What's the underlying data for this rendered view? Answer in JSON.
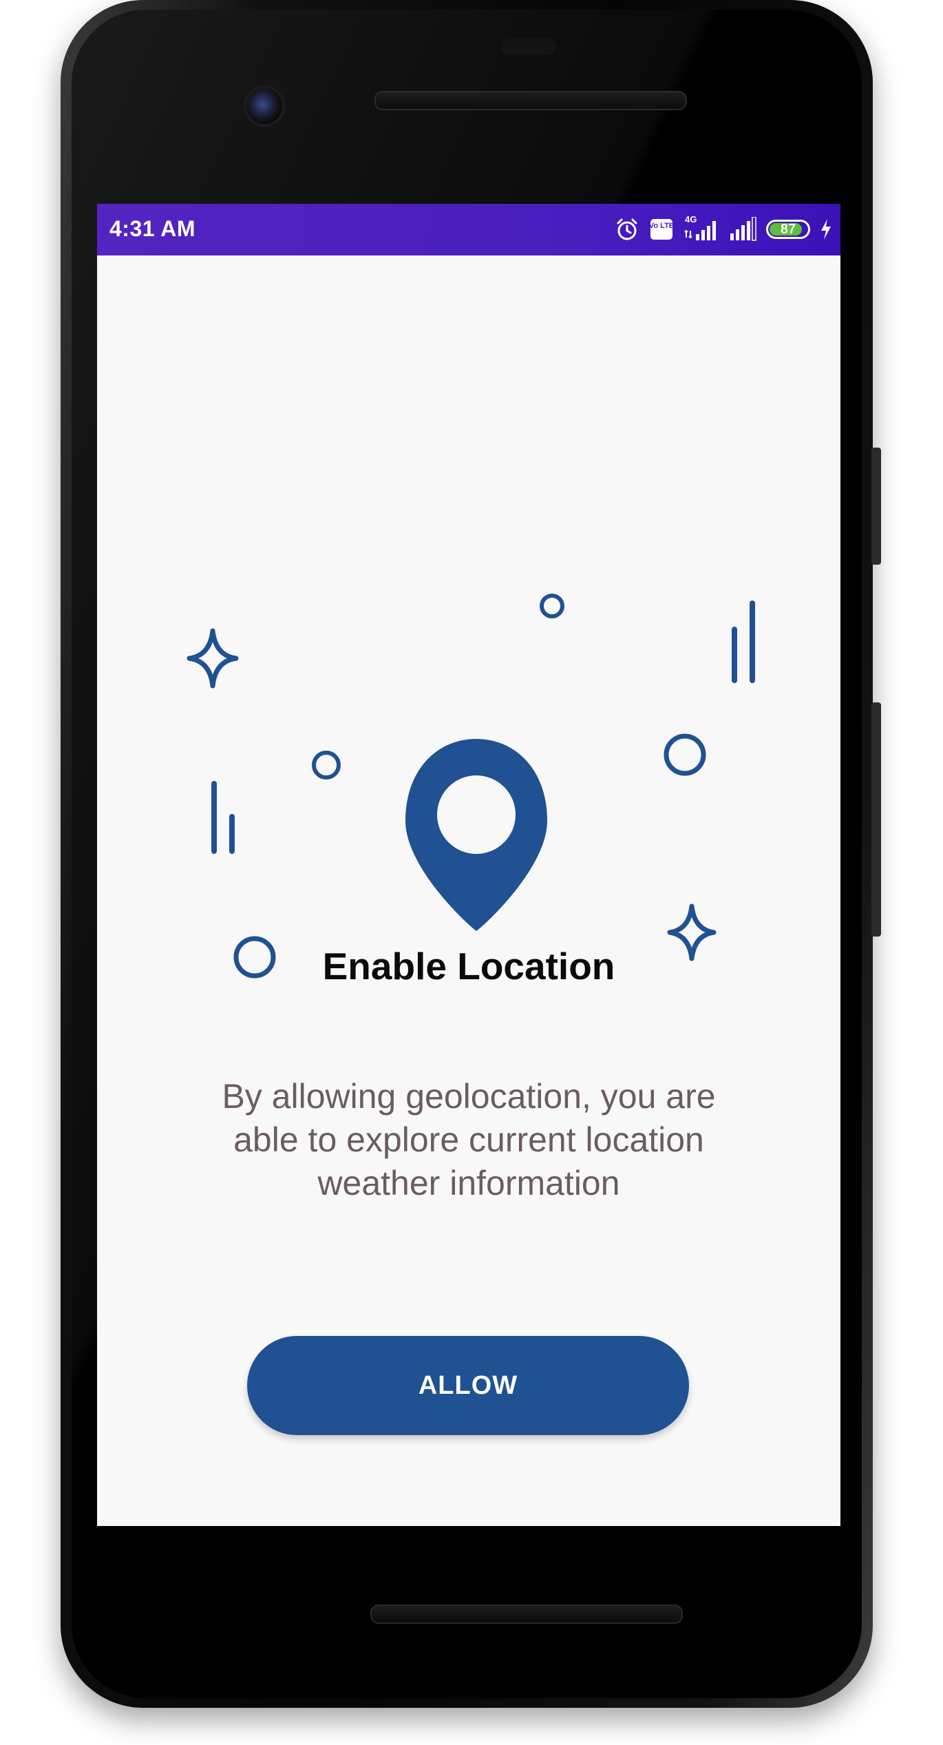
{
  "status_bar": {
    "time": "4:31 AM",
    "network_label": "4G",
    "volte_label": "Vo LTE",
    "battery_level": "87",
    "battery_fraction": 0.87,
    "icons": [
      "alarm-icon",
      "volte-icon",
      "signal-4g-icon",
      "signal-icon",
      "battery-icon",
      "charging-icon"
    ],
    "background_color": "#4a1fbf"
  },
  "illustration": {
    "icons": [
      "location-pin-icon",
      "sparkle-icon",
      "circle-icon",
      "bars-icon"
    ],
    "accent_color": "#1f5193"
  },
  "content": {
    "title": "Enable Location",
    "description": "By allowing geolocation, you are able to explore current location weather information"
  },
  "actions": {
    "allow_label": "ALLOW",
    "allow_color": "#1f5193"
  }
}
